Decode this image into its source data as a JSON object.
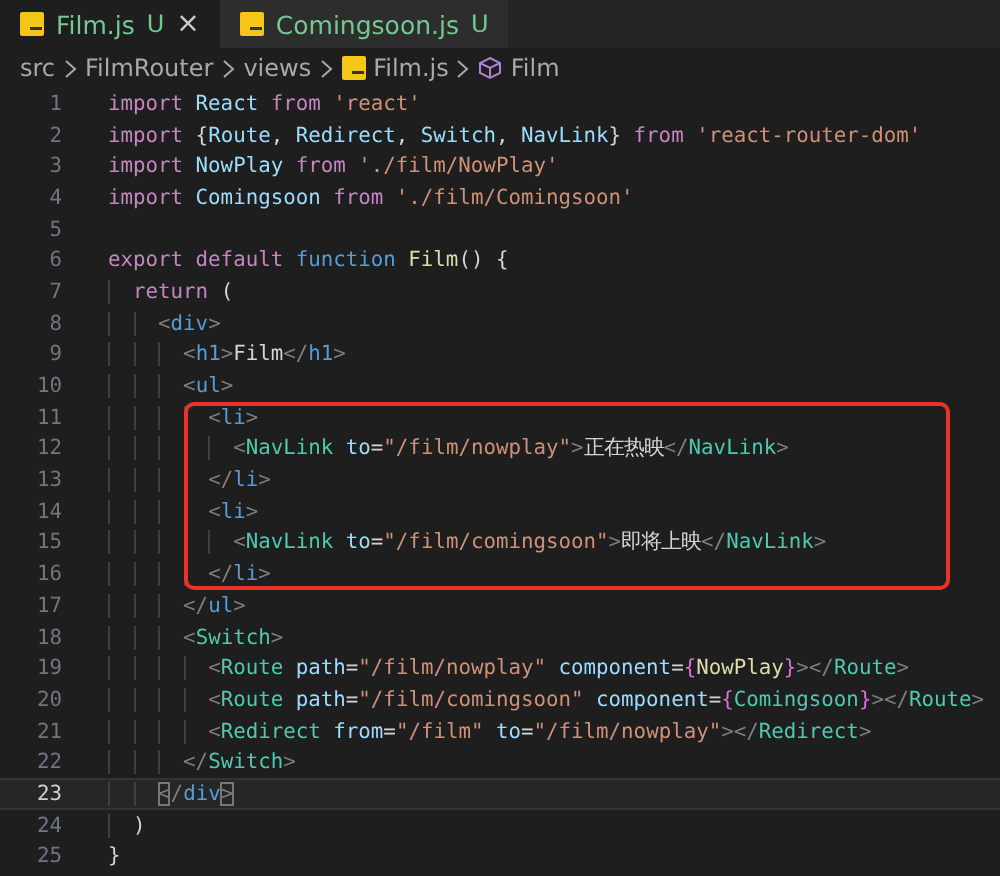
{
  "tabs": [
    {
      "label": "Film.js",
      "badge": "U",
      "close": "×",
      "selected": true
    },
    {
      "label": "Comingsoon.js",
      "badge": "U",
      "selected": false
    }
  ],
  "breadcrumb": [
    {
      "label": "src",
      "kind": "folder"
    },
    {
      "label": "FilmRouter",
      "kind": "folder"
    },
    {
      "label": "views",
      "kind": "folder"
    },
    {
      "label": "Film.js",
      "kind": "file"
    },
    {
      "label": "Film",
      "kind": "symbol"
    }
  ],
  "lines": [
    {
      "number": "1",
      "boxed": false,
      "current": false,
      "tokens": [
        {
          "kind": "kw",
          "text": "import "
        },
        {
          "kind": "var",
          "text": "React "
        },
        {
          "kind": "kw",
          "text": "from "
        },
        {
          "kind": "str",
          "text": "'react'"
        }
      ]
    },
    {
      "number": "2",
      "boxed": false,
      "current": false,
      "tokens": [
        {
          "kind": "kw",
          "text": "import "
        },
        {
          "kind": "text",
          "text": "{"
        },
        {
          "kind": "var",
          "text": "Route"
        },
        {
          "kind": "text",
          "text": ", "
        },
        {
          "kind": "var",
          "text": "Redirect"
        },
        {
          "kind": "text",
          "text": ", "
        },
        {
          "kind": "var",
          "text": "Switch"
        },
        {
          "kind": "text",
          "text": ", "
        },
        {
          "kind": "var",
          "text": "NavLink"
        },
        {
          "kind": "text",
          "text": "} "
        },
        {
          "kind": "kw",
          "text": "from "
        },
        {
          "kind": "str",
          "text": "'react-router-dom'"
        }
      ]
    },
    {
      "number": "3",
      "boxed": false,
      "current": false,
      "tokens": [
        {
          "kind": "kw",
          "text": "import "
        },
        {
          "kind": "var",
          "text": "NowPlay "
        },
        {
          "kind": "kw",
          "text": "from "
        },
        {
          "kind": "str",
          "text": "'./film/NowPlay'"
        }
      ]
    },
    {
      "number": "4",
      "boxed": false,
      "current": false,
      "tokens": [
        {
          "kind": "kw",
          "text": "import "
        },
        {
          "kind": "var",
          "text": "Comingsoon "
        },
        {
          "kind": "kw",
          "text": "from "
        },
        {
          "kind": "str",
          "text": "'./film/Comingsoon'"
        }
      ]
    },
    {
      "number": "5",
      "boxed": false,
      "current": false
    },
    {
      "number": "6",
      "boxed": false,
      "current": false,
      "tokens": [
        {
          "kind": "kw",
          "text": "export "
        },
        {
          "kind": "kw",
          "text": "default "
        },
        {
          "kind": "storage",
          "text": "function "
        },
        {
          "kind": "fn",
          "text": "Film"
        },
        {
          "kind": "text",
          "text": "() {"
        }
      ]
    },
    {
      "number": "7",
      "boxed": false,
      "current": false,
      "tokens": [
        {
          "kind": "kw",
          "text": "  return "
        },
        {
          "kind": "text",
          "text": "("
        }
      ]
    },
    {
      "number": "8",
      "boxed": false,
      "current": false,
      "tokens": [
        {
          "kind": "punct",
          "text": "    <"
        },
        {
          "kind": "tag",
          "text": "div"
        },
        {
          "kind": "punct",
          "text": ">"
        }
      ]
    },
    {
      "number": "9",
      "boxed": false,
      "current": false,
      "tokens": [
        {
          "kind": "punct",
          "text": "      <"
        },
        {
          "kind": "tag",
          "text": "h1"
        },
        {
          "kind": "punct",
          "text": ">"
        },
        {
          "kind": "text",
          "text": "Film"
        },
        {
          "kind": "punct",
          "text": "</"
        },
        {
          "kind": "tag",
          "text": "h1"
        },
        {
          "kind": "punct",
          "text": ">"
        }
      ]
    },
    {
      "number": "10",
      "boxed": false,
      "current": false,
      "tokens": [
        {
          "kind": "punct",
          "text": "      <"
        },
        {
          "kind": "tag",
          "text": "ul"
        },
        {
          "kind": "punct",
          "text": ">"
        }
      ]
    },
    {
      "number": "11",
      "boxed": true,
      "current": false,
      "tokens": [
        {
          "kind": "punct",
          "text": "        <"
        },
        {
          "kind": "tag",
          "text": "li"
        },
        {
          "kind": "punct",
          "text": ">"
        }
      ]
    },
    {
      "number": "12",
      "boxed": true,
      "current": false,
      "tokens": [
        {
          "kind": "punct",
          "text": "          <"
        },
        {
          "kind": "comp",
          "text": "NavLink "
        },
        {
          "kind": "attr",
          "text": "to"
        },
        {
          "kind": "text",
          "text": "="
        },
        {
          "kind": "str",
          "text": "\"/film/nowplay\""
        },
        {
          "kind": "punct",
          "text": ">"
        },
        {
          "kind": "text",
          "text": "正在热映"
        },
        {
          "kind": "punct",
          "text": "</"
        },
        {
          "kind": "comp",
          "text": "NavLink"
        },
        {
          "kind": "punct",
          "text": ">"
        }
      ]
    },
    {
      "number": "13",
      "boxed": true,
      "current": false,
      "tokens": [
        {
          "kind": "punct",
          "text": "        </"
        },
        {
          "kind": "tag",
          "text": "li"
        },
        {
          "kind": "punct",
          "text": ">"
        }
      ]
    },
    {
      "number": "14",
      "boxed": true,
      "current": false,
      "tokens": [
        {
          "kind": "punct",
          "text": "        <"
        },
        {
          "kind": "tag",
          "text": "li"
        },
        {
          "kind": "punct",
          "text": ">"
        }
      ]
    },
    {
      "number": "15",
      "boxed": true,
      "current": false,
      "tokens": [
        {
          "kind": "punct",
          "text": "          <"
        },
        {
          "kind": "comp",
          "text": "NavLink "
        },
        {
          "kind": "attr",
          "text": "to"
        },
        {
          "kind": "text",
          "text": "="
        },
        {
          "kind": "str",
          "text": "\"/film/comingsoon\""
        },
        {
          "kind": "punct",
          "text": ">"
        },
        {
          "kind": "text",
          "text": "即将上映"
        },
        {
          "kind": "punct",
          "text": "</"
        },
        {
          "kind": "comp",
          "text": "NavLink"
        },
        {
          "kind": "punct",
          "text": ">"
        }
      ]
    },
    {
      "number": "16",
      "boxed": true,
      "current": false,
      "tokens": [
        {
          "kind": "punct",
          "text": "        </"
        },
        {
          "kind": "tag",
          "text": "li"
        },
        {
          "kind": "punct",
          "text": ">"
        }
      ]
    },
    {
      "number": "17",
      "boxed": false,
      "current": false,
      "tokens": [
        {
          "kind": "punct",
          "text": "      </"
        },
        {
          "kind": "tag",
          "text": "ul"
        },
        {
          "kind": "punct",
          "text": ">"
        }
      ]
    },
    {
      "number": "18",
      "boxed": false,
      "current": false,
      "tokens": [
        {
          "kind": "punct",
          "text": "      <"
        },
        {
          "kind": "comp",
          "text": "Switch"
        },
        {
          "kind": "punct",
          "text": ">"
        }
      ]
    },
    {
      "number": "19",
      "boxed": false,
      "current": false,
      "tokens": [
        {
          "kind": "punct",
          "text": "        <"
        },
        {
          "kind": "comp",
          "text": "Route "
        },
        {
          "kind": "attr",
          "text": "path"
        },
        {
          "kind": "text",
          "text": "="
        },
        {
          "kind": "str",
          "text": "\"/film/nowplay\" "
        },
        {
          "kind": "attr",
          "text": "component"
        },
        {
          "kind": "text",
          "text": "="
        },
        {
          "kind": "brace",
          "text": "{"
        },
        {
          "kind": "fn",
          "text": "NowPlay"
        },
        {
          "kind": "brace",
          "text": "}"
        },
        {
          "kind": "punct",
          "text": "></"
        },
        {
          "kind": "comp",
          "text": "Route"
        },
        {
          "kind": "punct",
          "text": ">"
        }
      ]
    },
    {
      "number": "20",
      "boxed": false,
      "current": false,
      "tokens": [
        {
          "kind": "punct",
          "text": "        <"
        },
        {
          "kind": "comp",
          "text": "Route "
        },
        {
          "kind": "attr",
          "text": "path"
        },
        {
          "kind": "text",
          "text": "="
        },
        {
          "kind": "str",
          "text": "\"/film/comingsoon\" "
        },
        {
          "kind": "attr",
          "text": "component"
        },
        {
          "kind": "text",
          "text": "="
        },
        {
          "kind": "brace",
          "text": "{"
        },
        {
          "kind": "comp",
          "text": "Comingsoon"
        },
        {
          "kind": "brace",
          "text": "}"
        },
        {
          "kind": "punct",
          "text": "></"
        },
        {
          "kind": "comp",
          "text": "Route"
        },
        {
          "kind": "punct",
          "text": ">"
        }
      ]
    },
    {
      "number": "21",
      "boxed": false,
      "current": false,
      "tokens": [
        {
          "kind": "punct",
          "text": "        <"
        },
        {
          "kind": "comp",
          "text": "Redirect "
        },
        {
          "kind": "attr",
          "text": "from"
        },
        {
          "kind": "text",
          "text": "="
        },
        {
          "kind": "str",
          "text": "\"/film\" "
        },
        {
          "kind": "attr",
          "text": "to"
        },
        {
          "kind": "text",
          "text": "="
        },
        {
          "kind": "str",
          "text": "\"/film/nowplay\""
        },
        {
          "kind": "punct",
          "text": "></"
        },
        {
          "kind": "comp",
          "text": "Redirect"
        },
        {
          "kind": "punct",
          "text": ">"
        }
      ]
    },
    {
      "number": "22",
      "boxed": false,
      "current": false,
      "tokens": [
        {
          "kind": "punct",
          "text": "      </"
        },
        {
          "kind": "comp",
          "text": "Switch"
        },
        {
          "kind": "punct",
          "text": ">"
        }
      ]
    },
    {
      "number": "23",
      "boxed": false,
      "current": true,
      "tokens": [
        {
          "kind": "match",
          "text": "    <"
        },
        {
          "kind": "punct",
          "text": "/"
        },
        {
          "kind": "tag",
          "text": "div"
        },
        {
          "kind": "match",
          "text": ">"
        }
      ]
    },
    {
      "number": "24",
      "boxed": false,
      "current": false,
      "tokens": [
        {
          "kind": "text",
          "text": "  )"
        }
      ]
    },
    {
      "number": "25",
      "boxed": false,
      "current": false,
      "tokens": [
        {
          "kind": "text",
          "text": "}"
        }
      ]
    }
  ]
}
